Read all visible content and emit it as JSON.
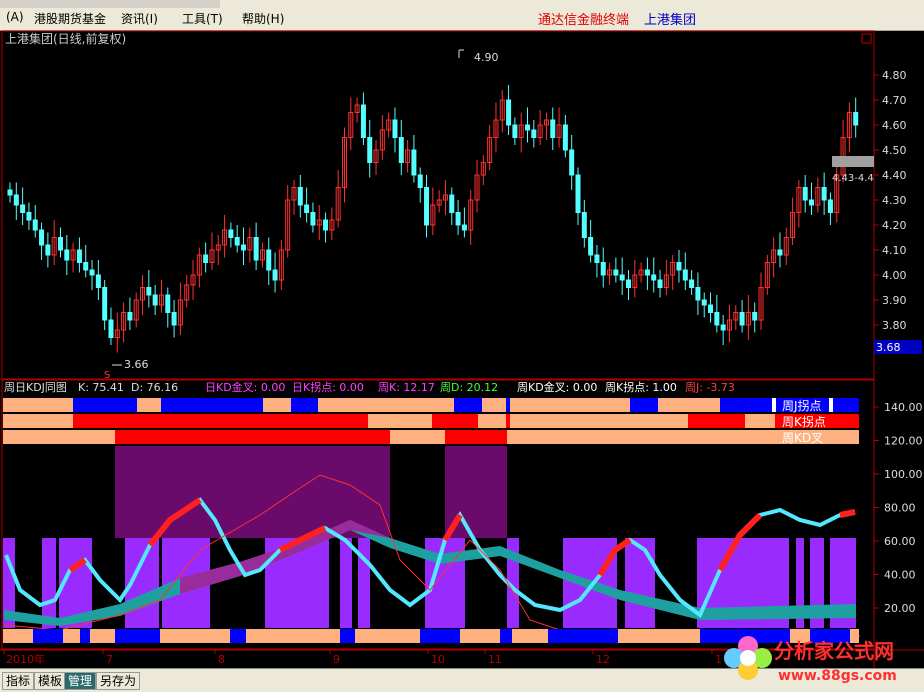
{
  "menu": {
    "items": [
      "(A)",
      "港股期货基金",
      "资讯(I)",
      "工具(T)",
      "帮助(H)"
    ],
    "right_title": "通达信金融终端",
    "right_company": "上港集团"
  },
  "main_chart": {
    "title": "上港集团(日线,前复权)",
    "price_ticks": [
      "4.80",
      "4.70",
      "4.60",
      "4.50",
      "4.40",
      "4.30",
      "4.20",
      "4.10",
      "4.00",
      "3.90",
      "3.80"
    ],
    "high_label": "4.90",
    "low_label": "3.66",
    "range_label": "4.43-4.4",
    "current_price": "3.68",
    "marker": "S"
  },
  "indicator": {
    "name": "周日KDJ同图",
    "k_label": "K: 75.41",
    "d_label": "D: 76.16",
    "day_cross": "日KD金叉: 0.00",
    "day_k_turn": "日K拐点: 0.00",
    "week_k": "周K: 12.17",
    "week_d": "周D: 20.12",
    "week_cross": "周KD金叉: 0.00",
    "week_k_turn": "周K拐点: 1.00",
    "week_j": "周J: -3.73",
    "bar_labels": [
      "周J拐点",
      "周K拐点",
      "周KD叉"
    ],
    "ticks": [
      "140.00",
      "120.00",
      "100.00",
      "80.00",
      "60.00",
      "40.00",
      "20.00"
    ]
  },
  "timeline": {
    "labels": [
      "2010年",
      "7",
      "8",
      "9",
      "10",
      "11",
      "12",
      "1"
    ]
  },
  "statusbar": {
    "buttons": [
      "指标",
      "模板",
      "管理",
      "另存为"
    ],
    "active": "管理"
  },
  "watermark": {
    "text": "分析家公式网",
    "url": "www.88gs.com"
  },
  "colors": {
    "up": "#ff3030",
    "down": "#54ffff",
    "axis": "#b00000",
    "purple": "#9a2bff",
    "orange": "#ffb07f",
    "blue": "#0000ff",
    "teal": "#1fa0a0"
  },
  "chart_data": {
    "type": "candlestick",
    "x_labels": [
      "7",
      "8",
      "9",
      "10",
      "11",
      "12",
      "1"
    ],
    "year_label": "2010年",
    "ylim": [
      3.64,
      4.92
    ],
    "closes": [
      4.32,
      4.28,
      4.25,
      4.22,
      4.18,
      4.12,
      4.08,
      4.15,
      4.1,
      4.06,
      4.1,
      4.05,
      4.02,
      4.0,
      3.95,
      3.82,
      3.75,
      3.78,
      3.85,
      3.82,
      3.9,
      3.95,
      3.92,
      3.88,
      3.92,
      3.85,
      3.8,
      3.9,
      3.96,
      4.0,
      4.08,
      4.05,
      4.1,
      4.12,
      4.18,
      4.15,
      4.12,
      4.1,
      4.15,
      4.06,
      4.1,
      4.02,
      3.98,
      4.1,
      4.3,
      4.35,
      4.28,
      4.25,
      4.2,
      4.22,
      4.18,
      4.22,
      4.35,
      4.55,
      4.65,
      4.68,
      4.55,
      4.45,
      4.5,
      4.58,
      4.62,
      4.55,
      4.45,
      4.5,
      4.4,
      4.35,
      4.2,
      4.28,
      4.3,
      4.32,
      4.25,
      4.2,
      4.18,
      4.3,
      4.4,
      4.45,
      4.55,
      4.62,
      4.7,
      4.6,
      4.55,
      4.6,
      4.58,
      4.55,
      4.6,
      4.62,
      4.55,
      4.6,
      4.5,
      4.4,
      4.25,
      4.15,
      4.08,
      4.05,
      4.0,
      4.02,
      4.0,
      3.98,
      3.95,
      4.0,
      4.02,
      4.0,
      3.98,
      3.95,
      4.0,
      4.05,
      4.02,
      3.98,
      3.95,
      3.9,
      3.88,
      3.85,
      3.8,
      3.78,
      3.82,
      3.85,
      3.8,
      3.85,
      3.82,
      3.95,
      4.05,
      4.1,
      4.08,
      4.15,
      4.25,
      4.35,
      4.3,
      4.28,
      4.35,
      4.3,
      4.25,
      4.4,
      4.55,
      4.65,
      4.6
    ]
  }
}
